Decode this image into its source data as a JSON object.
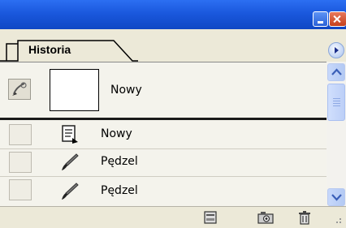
{
  "window": {
    "minimize_icon": "minimize-icon",
    "close_icon": "close-icon"
  },
  "panel": {
    "tab_label": "Historia",
    "menu_icon": "panel-menu-arrow-icon"
  },
  "snapshot": {
    "label": "Nowy",
    "source_icon": "history-brush-icon"
  },
  "history": [
    {
      "label": "Nowy",
      "icon": "new-document-icon"
    },
    {
      "label": "Pędzel",
      "icon": "brush-icon"
    },
    {
      "label": "Pędzel",
      "icon": "brush-icon"
    }
  ],
  "toolbar": {
    "buttons": [
      {
        "icon": "new-document-from-state-icon"
      },
      {
        "icon": "create-snapshot-icon"
      },
      {
        "icon": "delete-state-icon"
      }
    ]
  }
}
